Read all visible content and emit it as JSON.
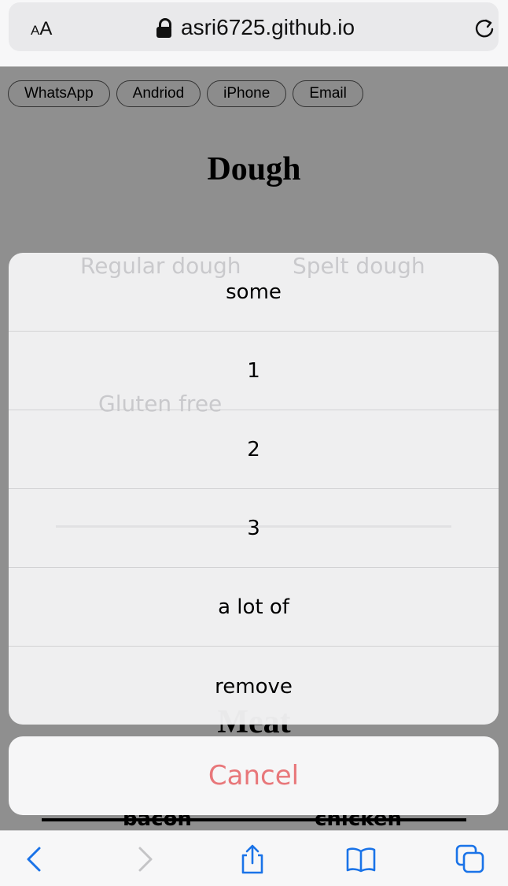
{
  "browser": {
    "text_size_label_small": "A",
    "text_size_label_large": "A",
    "url": "asri6725.github.io"
  },
  "page": {
    "nav_buttons": [
      "WhatsApp",
      "Andriod",
      "iPhone",
      "Email"
    ],
    "section_dough": "Dough",
    "dough_options": [
      "Regular dough",
      "Spelt dough",
      "Gluten free"
    ],
    "section_meat": "Meat",
    "meat_options": [
      "bacon",
      "chicken"
    ]
  },
  "action_sheet": {
    "options": [
      "some",
      "1",
      "2",
      "3",
      "a lot of",
      "remove"
    ],
    "cancel": "Cancel"
  },
  "colors": {
    "accent_cancel": "#e8777a",
    "overlay": "#8f8f8f"
  }
}
